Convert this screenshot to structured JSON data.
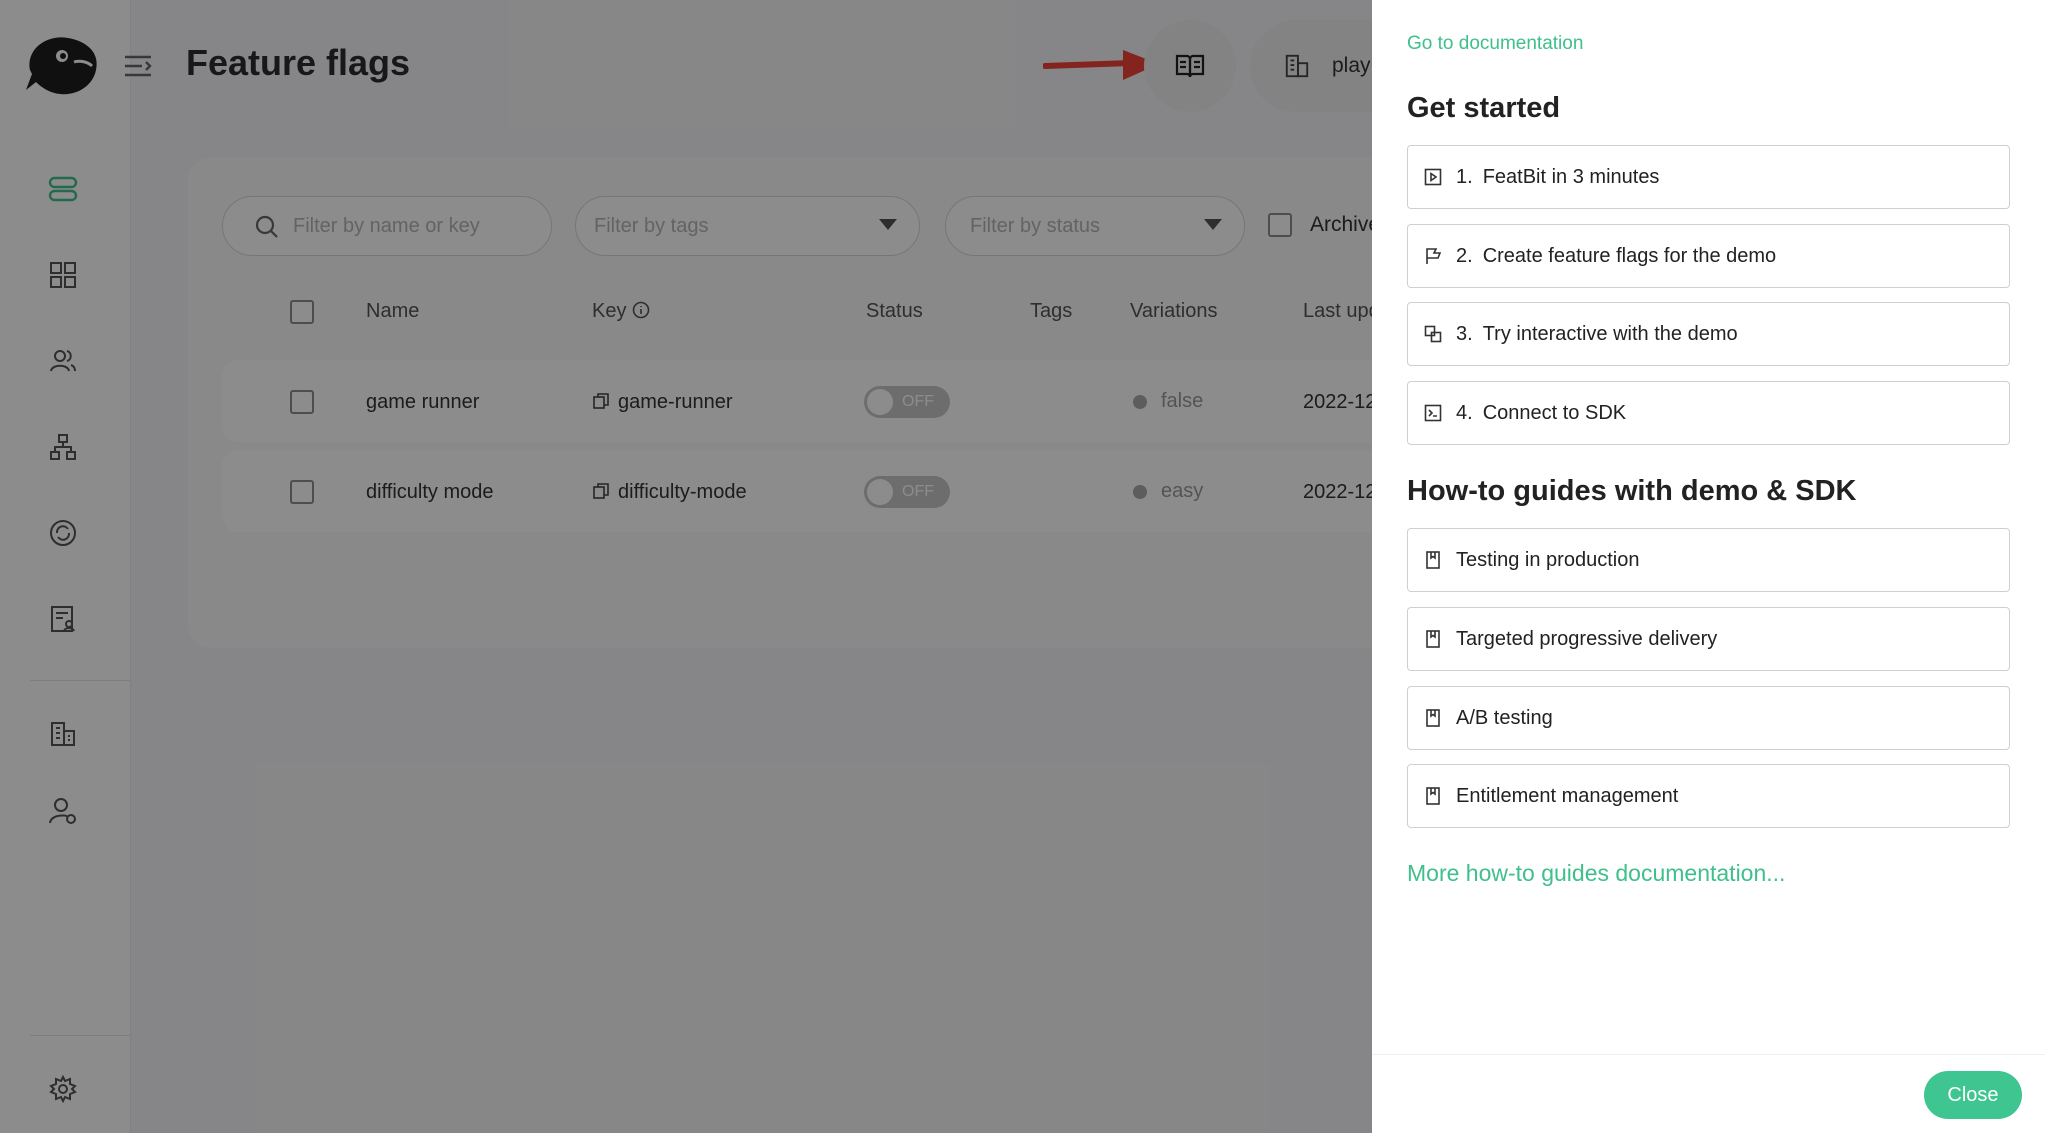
{
  "app": {
    "page_title": "Feature flags"
  },
  "sidebar": {
    "items": [
      "feature-flags",
      "dashboard",
      "users",
      "segments",
      "integrations",
      "audit-log",
      "organization",
      "account"
    ],
    "settings_icon": "gear-icon"
  },
  "header": {
    "workspace_label": "play",
    "docs_icon": "book-open-icon"
  },
  "filters": {
    "search_placeholder": "Filter by name or key",
    "tags_placeholder": "Filter by tags",
    "status_placeholder": "Filter by status",
    "archived_label": "Archive"
  },
  "table": {
    "headers": {
      "name": "Name",
      "key": "Key",
      "status": "Status",
      "tags": "Tags",
      "variations": "Variations",
      "last_updated": "Last upd"
    },
    "rows": [
      {
        "name": "game runner",
        "key": "game-runner",
        "status": "OFF",
        "variation": "false",
        "date": "2022-12"
      },
      {
        "name": "difficulty mode",
        "key": "difficulty-mode",
        "status": "OFF",
        "variation": "easy",
        "date": "2022-12"
      }
    ]
  },
  "drawer": {
    "doc_link": "Go to documentation",
    "get_started_title": "Get started",
    "get_started": [
      {
        "num": "1.",
        "label": "FeatBit in 3 minutes",
        "icon": "play-square-icon"
      },
      {
        "num": "2.",
        "label": "Create feature flags for the demo",
        "icon": "flag-icon"
      },
      {
        "num": "3.",
        "label": "Try interactive with the demo",
        "icon": "interaction-icon"
      },
      {
        "num": "4.",
        "label": "Connect to SDK",
        "icon": "code-icon"
      }
    ],
    "howto_title": "How-to guides with demo & SDK",
    "howto": [
      {
        "label": "Testing in production",
        "icon": "book-icon"
      },
      {
        "label": "Targeted progressive delivery",
        "icon": "book-icon"
      },
      {
        "label": "A/B testing",
        "icon": "book-icon"
      },
      {
        "label": "Entitlement management",
        "icon": "book-icon"
      }
    ],
    "more_link": "More how-to guides documentation...",
    "close_label": "Close"
  },
  "colors": {
    "accent": "#3fbf8c",
    "close_button": "#3fc58f",
    "arrow": "#f0433a"
  }
}
